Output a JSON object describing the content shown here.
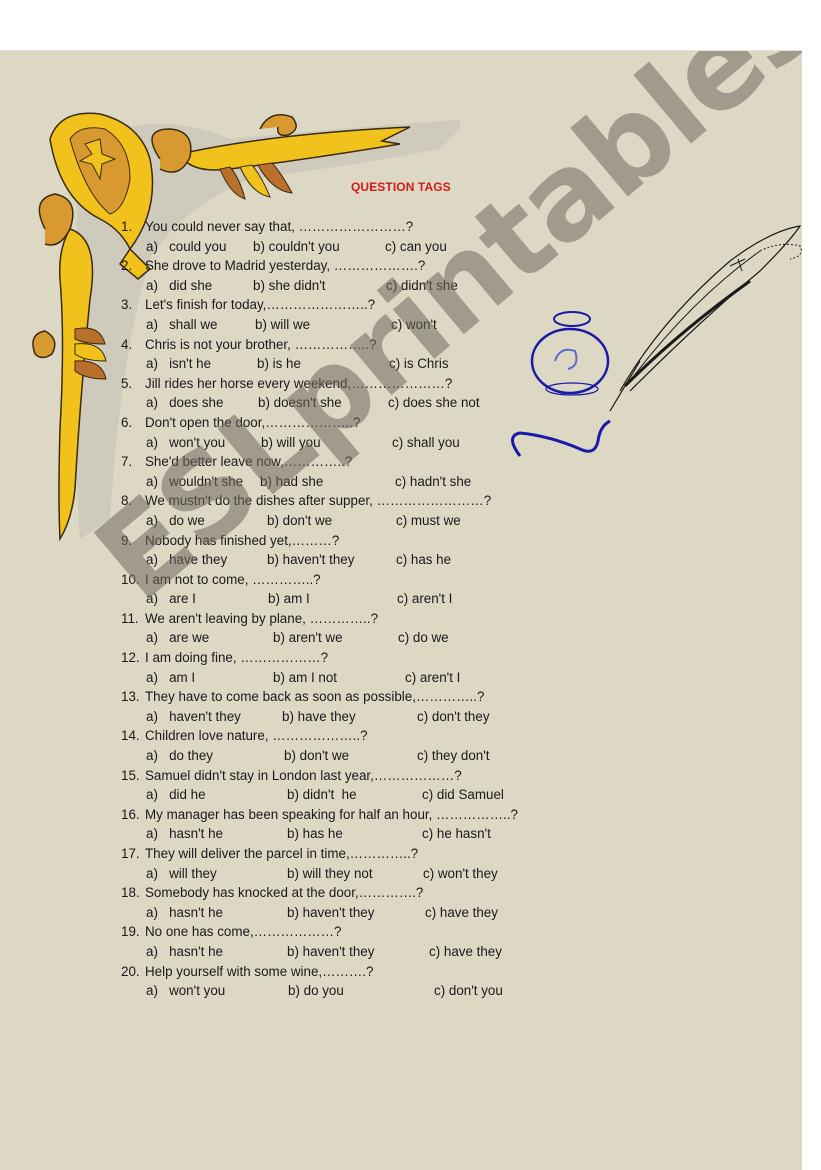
{
  "title": "QUESTION TAGS",
  "watermark": "ESLprintables.com",
  "colors": {
    "page_background": "#ddd8c3",
    "title": "#d11a1a",
    "ornament_gold": "#f2c21c",
    "ornament_brown": "#b8702a",
    "inkwell_blue": "#1a1aa8"
  },
  "questions": [
    {
      "num": "1.",
      "text": "You could never say that, ……………………?",
      "options": [
        "a)   could you",
        "b) couldn't you",
        "c) can you"
      ]
    },
    {
      "num": "2.",
      "text": "She drove to Madrid yesterday, ……………….?",
      "options": [
        "a)   did she",
        "b) she didn't",
        "c) didn't she"
      ]
    },
    {
      "num": "3.",
      "text": "Let's finish for today,…………………..?",
      "options": [
        "a)   shall we",
        "b) will we",
        "c) won't"
      ]
    },
    {
      "num": "4.",
      "text": "Chris is not your brother, ……………..?",
      "options": [
        "a)   isn't he",
        "b) is he",
        "c) is Chris"
      ]
    },
    {
      "num": "5.",
      "text": "Jill rides her horse every weekend,…………………?",
      "options": [
        "a)   does she",
        "b) doesn't she",
        "c) does she not"
      ]
    },
    {
      "num": "6.",
      "text": "Don't open the door,………………..?",
      "options": [
        "a)   won't you",
        "b) will you",
        "c) shall you"
      ]
    },
    {
      "num": "7.",
      "text": "She'd better leave now,…………..?",
      "options": [
        "a)   wouldn't she",
        "b) had she",
        "c) hadn't she"
      ]
    },
    {
      "num": "8.",
      "text": "We mustn't do the dishes after supper, ……………………?",
      "options": [
        "a)   do we",
        "b) don't we",
        "c) must we"
      ]
    },
    {
      "num": "9.",
      "text": "Nobody has finished yet,………?",
      "options": [
        "a)   have they",
        "b) haven't they",
        "c) has he"
      ]
    },
    {
      "num": "10.",
      "text": "I am not to come, …………..?",
      "options": [
        "a)   are I",
        "b) am I",
        "c) aren't I"
      ]
    },
    {
      "num": "11.",
      "text": "We aren't leaving by plane, …………..?",
      "options": [
        "a)   are we",
        "b) aren't we",
        "c) do we"
      ]
    },
    {
      "num": "12.",
      "text": "I am doing fine, ………………?",
      "options": [
        "a)   am I",
        "b) am I not",
        "c) aren't I"
      ]
    },
    {
      "num": "13.",
      "text": "They have to come back as soon as possible,…………..?",
      "options": [
        "a)   haven't they",
        "b) have they",
        "c) don't they"
      ]
    },
    {
      "num": "14.",
      "text": "Children love nature, ………………..?",
      "options": [
        "a)   do they",
        "b) don't we",
        "c) they don't"
      ]
    },
    {
      "num": "15.",
      "text": "Samuel didn't stay in London last year,………………?",
      "options": [
        "a)   did he",
        "b) didn't  he",
        "c) did Samuel"
      ]
    },
    {
      "num": "16.",
      "text": "My manager has been speaking for half an hour, ……………..?",
      "options": [
        "a)   hasn't he",
        "b) has he",
        "c) he hasn't"
      ]
    },
    {
      "num": "17.",
      "text": "They will deliver the parcel in time,…………..?",
      "options": [
        "a)   will they",
        "b) will they not",
        "c) won't they"
      ]
    },
    {
      "num": "18.",
      "text": "Somebody has knocked at the door,………….?",
      "options": [
        "a)   hasn't he",
        "b) haven't they",
        "c) have they"
      ]
    },
    {
      "num": "19.",
      "text": "No one has come,………………?",
      "options": [
        "a)   hasn't he",
        "b) haven't they",
        "c) have they"
      ]
    },
    {
      "num": "20.",
      "text": "Help yourself with some wine,……….?",
      "options": [
        "a)   won't you",
        "b) do you",
        "c) don't you"
      ]
    }
  ]
}
